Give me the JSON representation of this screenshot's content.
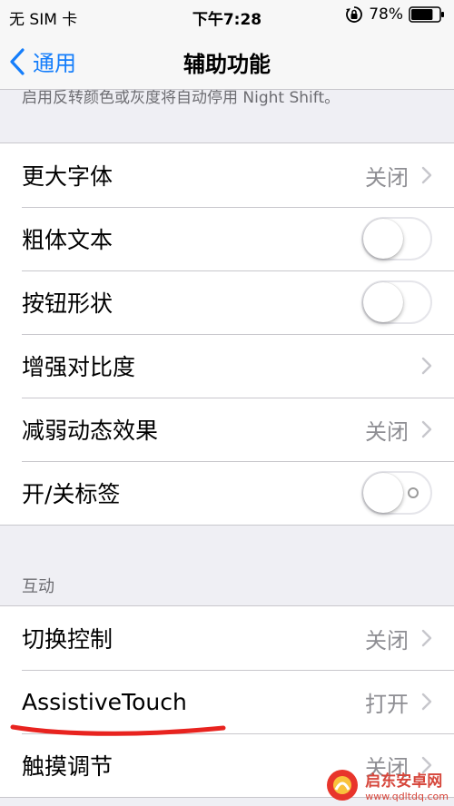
{
  "status_bar": {
    "carrier": "无 SIM 卡",
    "time": "下午7:28",
    "battery": "78%",
    "battery_level": 0.78
  },
  "nav": {
    "back_label": "通用",
    "title": "辅助功能"
  },
  "footnote": "启用反转颜色或灰度将自动停用 Night Shift。",
  "display_rows": [
    {
      "label": "更大字体",
      "value": "关闭",
      "type": "disclosure"
    },
    {
      "label": "粗体文本",
      "type": "toggle",
      "on": false
    },
    {
      "label": "按钮形状",
      "type": "toggle",
      "on": false
    },
    {
      "label": "增强对比度",
      "value": "",
      "type": "disclosure"
    },
    {
      "label": "减弱动态效果",
      "value": "关闭",
      "type": "disclosure"
    },
    {
      "label": "开/关标签",
      "type": "toggle",
      "on": false,
      "shows_label": true
    }
  ],
  "interaction_section": {
    "header": "互动",
    "rows": [
      {
        "label": "切换控制",
        "value": "关闭",
        "type": "disclosure"
      },
      {
        "label": "AssistiveTouch",
        "value": "打开",
        "type": "disclosure"
      },
      {
        "label": "触摸调节",
        "value": "关闭",
        "type": "disclosure"
      }
    ]
  },
  "annotation": {
    "color": "#e8231f"
  },
  "watermark": {
    "name": "启东安卓网",
    "url": "www.qdltdq.com"
  },
  "colors": {
    "accent": "#157efb",
    "background": "#efeff4",
    "secondary_text": "#8e8e93"
  }
}
